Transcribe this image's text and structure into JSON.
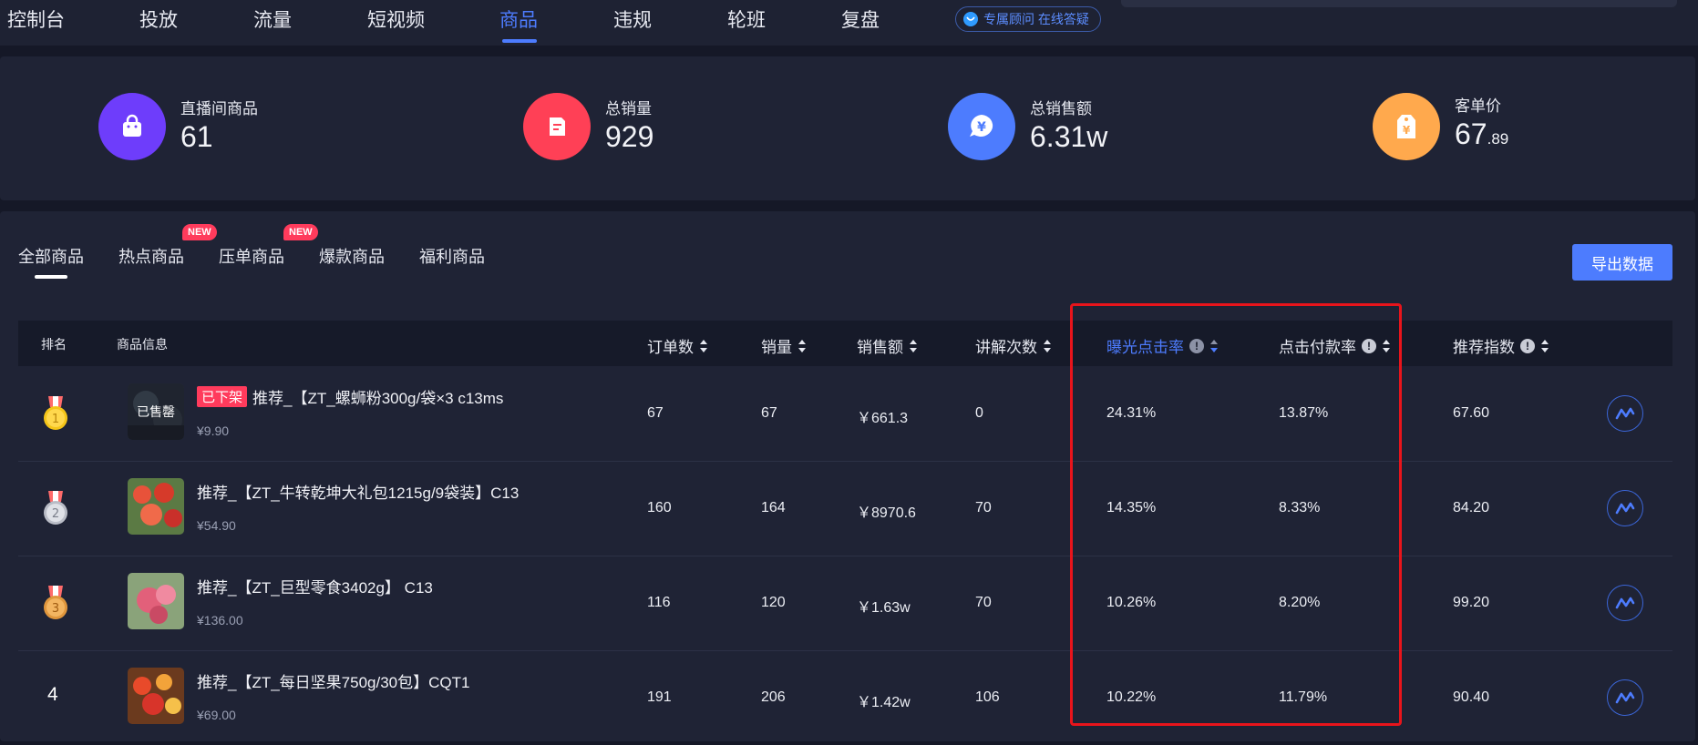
{
  "nav": {
    "items": [
      "控制台",
      "投放",
      "流量",
      "短视频",
      "商品",
      "违规",
      "轮班",
      "复盘"
    ],
    "active_index": 4,
    "advisor": "专属顾问 在线答疑"
  },
  "stats": [
    {
      "label": "直播间商品",
      "value": "61",
      "icon": "shopping-bag-icon",
      "color": "#6e3dfb"
    },
    {
      "label": "总销量",
      "value": "929",
      "icon": "document-icon",
      "color": "#ff4056"
    },
    {
      "label": "总销售额",
      "value": "6.31w",
      "icon": "yen-bubble-icon",
      "color": "#4d7cfe"
    },
    {
      "label": "客单价",
      "value_main": "67",
      "value_decimal": ".89",
      "icon": "price-tag-icon",
      "color": "#ffa94d"
    }
  ],
  "tabs": {
    "items": [
      "全部商品",
      "热点商品",
      "压单商品",
      "爆款商品",
      "福利商品"
    ],
    "new_badge": "NEW",
    "export": "导出数据"
  },
  "table": {
    "headers": {
      "rank": "排名",
      "info": "商品信息",
      "orders": "订单数",
      "sales": "销量",
      "amount": "销售额",
      "explain": "讲解次数",
      "ctr": "曝光点击率",
      "cvr": "点击付款率",
      "score": "推荐指数"
    },
    "rows": [
      {
        "rank": "1",
        "title": "推荐_【ZT_螺蛳粉300g/袋×3 c13ms",
        "price": "¥9.90",
        "orders": "67",
        "sales": "67",
        "amount": "￥661.3",
        "explain": "0",
        "ctr": "24.31%",
        "cvr": "13.87%",
        "score": "67.60",
        "offline": "已下架",
        "soldout": "已售罄"
      },
      {
        "rank": "2",
        "title": "推荐_【ZT_牛转乾坤大礼包1215g/9袋装】C13",
        "price": "¥54.90",
        "orders": "160",
        "sales": "164",
        "amount": "￥8970.6",
        "explain": "70",
        "ctr": "14.35%",
        "cvr": "8.33%",
        "score": "84.20"
      },
      {
        "rank": "3",
        "title": "推荐_【ZT_巨型零食3402g】 C13",
        "price": "¥136.00",
        "orders": "116",
        "sales": "120",
        "amount": "￥1.63w",
        "explain": "70",
        "ctr": "10.26%",
        "cvr": "8.20%",
        "score": "99.20"
      },
      {
        "rank": "4",
        "title": "推荐_【ZT_每日坚果750g/30包】CQT1",
        "price": "¥69.00",
        "orders": "191",
        "sales": "206",
        "amount": "￥1.42w",
        "explain": "106",
        "ctr": "10.22%",
        "cvr": "11.79%",
        "score": "90.40"
      }
    ]
  }
}
